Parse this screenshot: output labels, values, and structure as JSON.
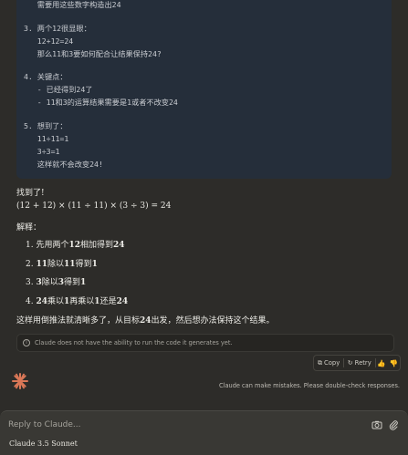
{
  "code_lines": [
    "   需要用这些数字构造出24",
    "",
    "3. 两个12很显眼：",
    "   12+12=24",
    "   那么11和3要如何配合让结果保持24?",
    "",
    "4. 关键点：",
    "   - 已经得到24了",
    "   - 11和3的运算结果需要是1或者不改变24",
    "",
    "5. 想到了：",
    "   11÷11=1",
    "   3÷3=1",
    "   这样就不会改变24!"
  ],
  "answer": {
    "found": "找到了!",
    "formula": "(12 + 12) × (11 ÷ 11) × (3 ÷ 3) = 24",
    "explain_label": "解释：",
    "steps": [
      {
        "num": "1.",
        "pre": "先用两个",
        "bold": "12",
        "post": "相加得到",
        "bold2": "24"
      },
      {
        "num": "2.",
        "pre": "",
        "bold": "11",
        "post": "除以",
        "bold2": "11",
        "post2": "得到",
        "bold3": "1"
      },
      {
        "num": "3.",
        "pre": "",
        "bold": "3",
        "post": "除以",
        "bold2": "3",
        "post2": "得到",
        "bold3": "1"
      },
      {
        "num": "4.",
        "pre": "",
        "bold": "24",
        "post": "乘以",
        "bold2": "1",
        "post2": "再乘以",
        "bold3": "1",
        "post3": "还是",
        "bold4": "24"
      }
    ],
    "conclusion_pre": "这样用倒推法就清晰多了，从目标",
    "conclusion_bold": "24",
    "conclusion_post": "出发，然后想办法保持这个结果。"
  },
  "notice": "Claude does not have the ability to run the code it generates yet.",
  "actions": {
    "copy": "Copy",
    "retry": "Retry"
  },
  "disclaimer": "Claude can make mistakes. Please double-check responses.",
  "composer": {
    "placeholder": "Reply to Claude...",
    "model": "Claude 3.5 Sonnet"
  },
  "colors": {
    "accent": "#d97757",
    "code_bg": "#252e3a",
    "page_bg": "#2d2c29"
  }
}
